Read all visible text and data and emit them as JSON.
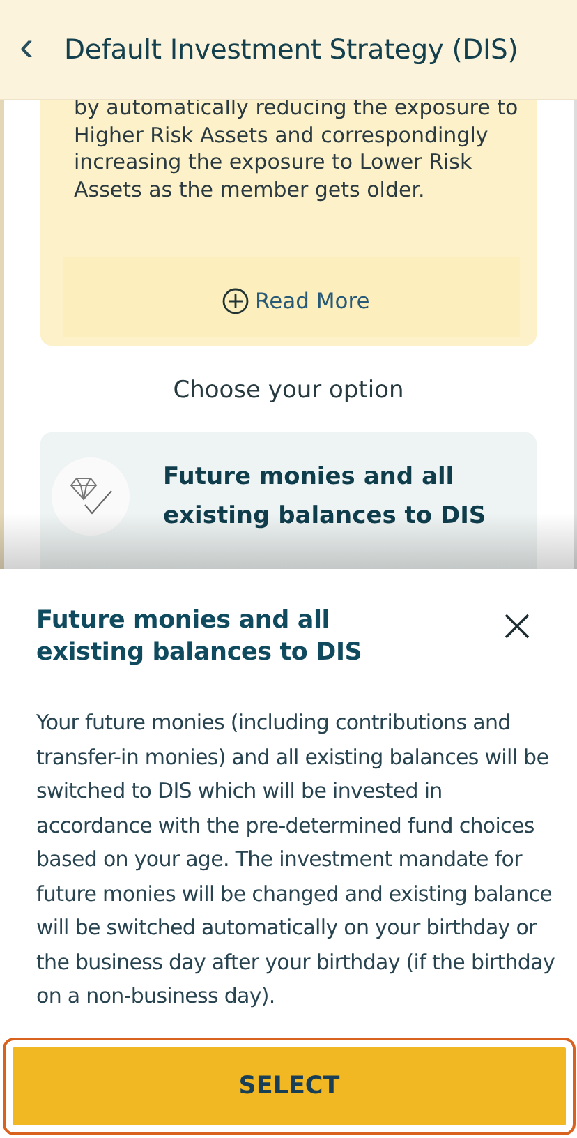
{
  "header": {
    "back_icon": "‹",
    "title": "Default Investment Strategy (DIS)"
  },
  "info_panel": {
    "text": "by automatically reducing the exposure to Higher Risk Assets and correspondingly increasing the exposure to Lower Risk Assets as the member gets older.",
    "read_more": "Read More"
  },
  "choose_label": "Choose your option",
  "options": [
    {
      "label": "Future monies and all existing balances to DIS"
    }
  ],
  "sheet": {
    "title": "Future monies and all existing balances to DIS",
    "body": "Your future monies (including contributions and transfer-in monies) and all existing balances will be switched to DIS which will be invested in accordance with the pre-determined fund choices based on your age. The investment mandate for future monies will be changed and existing balance will be switched automatically on your birthday or the business day after your birthday (if the birthday on a non-business day).",
    "button": "SELECT",
    "button_focused": true
  }
}
